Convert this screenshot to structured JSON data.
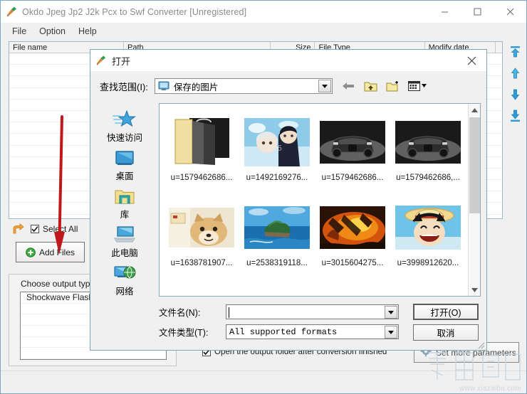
{
  "window": {
    "title": "Okdo Jpeg Jp2 J2k Pcx to Swf Converter [Unregistered]",
    "icon": "brush-icon",
    "controls": {
      "minimize": "minimize-icon",
      "maximize": "maximize-icon",
      "close": "close-icon"
    }
  },
  "menu": {
    "items": [
      {
        "label": "File"
      },
      {
        "label": "Option"
      },
      {
        "label": "Help"
      }
    ]
  },
  "file_list": {
    "columns": [
      {
        "label": "File name"
      },
      {
        "label": "Path"
      },
      {
        "label": "Size"
      },
      {
        "label": "File Type"
      },
      {
        "label": "Modify date"
      }
    ],
    "rows": []
  },
  "order_toolbar": {
    "buttons": [
      {
        "icon": "move-to-top-icon"
      },
      {
        "icon": "move-up-icon"
      },
      {
        "icon": "move-down-icon"
      },
      {
        "icon": "move-to-bottom-icon"
      }
    ]
  },
  "controls": {
    "return_icon": "return-arrow-icon",
    "select_all_label": "Select All",
    "select_all_checked": true,
    "add_files_label": "Add Files",
    "add_files_icon": "green-plus-icon"
  },
  "output": {
    "label": "Choose output type:",
    "items": [
      {
        "label": "Shockwave Flash"
      }
    ]
  },
  "bottom": {
    "open_folder_label": "Open the output folder after conversion finished",
    "open_folder_checked": true,
    "set_more_label": "Set more parameters",
    "set_more_icon": "gear-icon"
  },
  "dialog": {
    "title": "打开",
    "icon": "brush-icon",
    "close": "close-icon",
    "look_in_label": "查找范围(I):",
    "look_in_value": "保存的图片",
    "look_in_icon": "monitor-icon",
    "toolbar": [
      {
        "icon": "back-arrow-icon"
      },
      {
        "icon": "up-folder-icon"
      },
      {
        "icon": "new-folder-icon"
      },
      {
        "icon": "views-icon"
      }
    ],
    "places": [
      {
        "label": "快速访问",
        "icon": "quick-access-star-icon"
      },
      {
        "label": "桌面",
        "icon": "desktop-icon"
      },
      {
        "label": "库",
        "icon": "libraries-icon"
      },
      {
        "label": "此电脑",
        "icon": "this-pc-icon"
      },
      {
        "label": "网络",
        "icon": "network-icon"
      }
    ],
    "files": [
      {
        "label": "u=1579462686...",
        "kind": "folder"
      },
      {
        "label": "u=1492169276...",
        "kind": "image-anime"
      },
      {
        "label": "u=1579462686...",
        "kind": "image-car"
      },
      {
        "label": "u=1579462686,...",
        "kind": "image-car"
      },
      {
        "label": "u=1638781907...",
        "kind": "image-dog"
      },
      {
        "label": "u=2538319118...",
        "kind": "image-island"
      },
      {
        "label": "u=3015604275...",
        "kind": "image-fire"
      },
      {
        "label": "u=3998912620...",
        "kind": "image-luffy"
      }
    ],
    "file_name_label": "文件名(N):",
    "file_name_value": "",
    "file_type_label": "文件类型(T):",
    "file_type_value": "All supported formats",
    "open_button": "打开(O)",
    "cancel_button": "取消"
  },
  "watermark": {
    "url": "www.xiazaiba.com"
  },
  "colors": {
    "window_border": "#7fa6c0",
    "title_text": "#8a8a8a",
    "accent_blue": "#2e9bd6",
    "annotation_red": "#c0171b",
    "dialog_bg": "#f0f0f0"
  }
}
